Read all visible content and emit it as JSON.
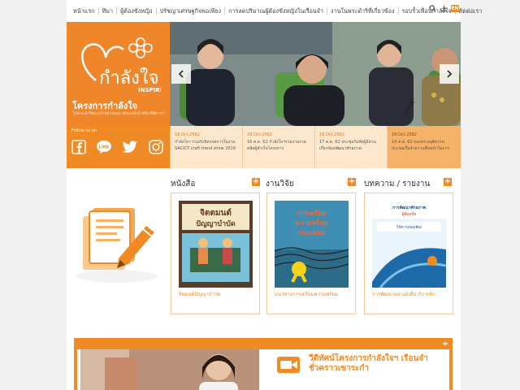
{
  "nav": {
    "items": [
      "หน้าแรก",
      "ทีมา",
      "ผู้ต้องขังหญิง",
      "ปรัชญาเศรษฐกิจพอเพียง",
      "การลดปริมาณผู้ต้องขังหญิงในเรือนจำ",
      "งานในพระดำริที่เกี่ยวข้อง",
      "รอบรั้วเพื่อนกำลังใจ",
      "ติดต่อเรา"
    ],
    "lang": "EN"
  },
  "brand": {
    "logo_text": "กำลังใจ",
    "logo_sub": "INSPIRE",
    "title": "โครงการกำลังใจ",
    "subtitle": "ในพระดำริพระเจ้าหลานเธอ พระองค์เจ้าพัชรกิติยาภา"
  },
  "follow_label": "Follow us on",
  "news": [
    {
      "date": "18.Oct.2562",
      "text": "กำลังใจฯ ร่วมกับนิทรรศการในงาน SACICT craft trend show 2019"
    },
    {
      "date": "18.Oct.2562",
      "text": "16 ต.ค. 62 กำลังใจฯร่วมงานรวม ตลิตผู้สำเร็จโครงการ"
    },
    {
      "date": "18.Oct.2562",
      "text": "17 ต.ค. 62 ประชุมรับฟังผู้มีส่วน เกี่ยวข้องพัฒนาศักยภาพ"
    },
    {
      "date": "18.Oct.2562",
      "text": "14 ต.ค. 62 กองทรวงยุติธรรม ประชุมเรือจำความคืบหน้าในการ"
    }
  ],
  "sections": {
    "books": {
      "title": "หนังสือ",
      "cover_title": "จิตตมนต์ ปัญญาบำบัด",
      "caption": "จิตมนต์ปัญญาบำบัด"
    },
    "research": {
      "title": "งานวิจัย",
      "cover_title": "การเตรียมความพร้อมก่อนปล่อย",
      "caption": "แนวทางการเตรียมความพร้อม"
    },
    "articles": {
      "title": "บทความ / รายงาน",
      "cover_title": "การพัฒนาศักยภาพผู้ต้องขัง",
      "caption": "การพัฒนาอย่างยั่งยืน กับ หลัก"
    }
  },
  "banner": {
    "title_line1": "วีดีทัศน์โครงการกำลังใจฯ เรือนจำ",
    "title_line2": "ชั่วคราวเขาระกำ"
  },
  "colors": {
    "accent": "#f08a24",
    "light": "#fde7cc"
  }
}
